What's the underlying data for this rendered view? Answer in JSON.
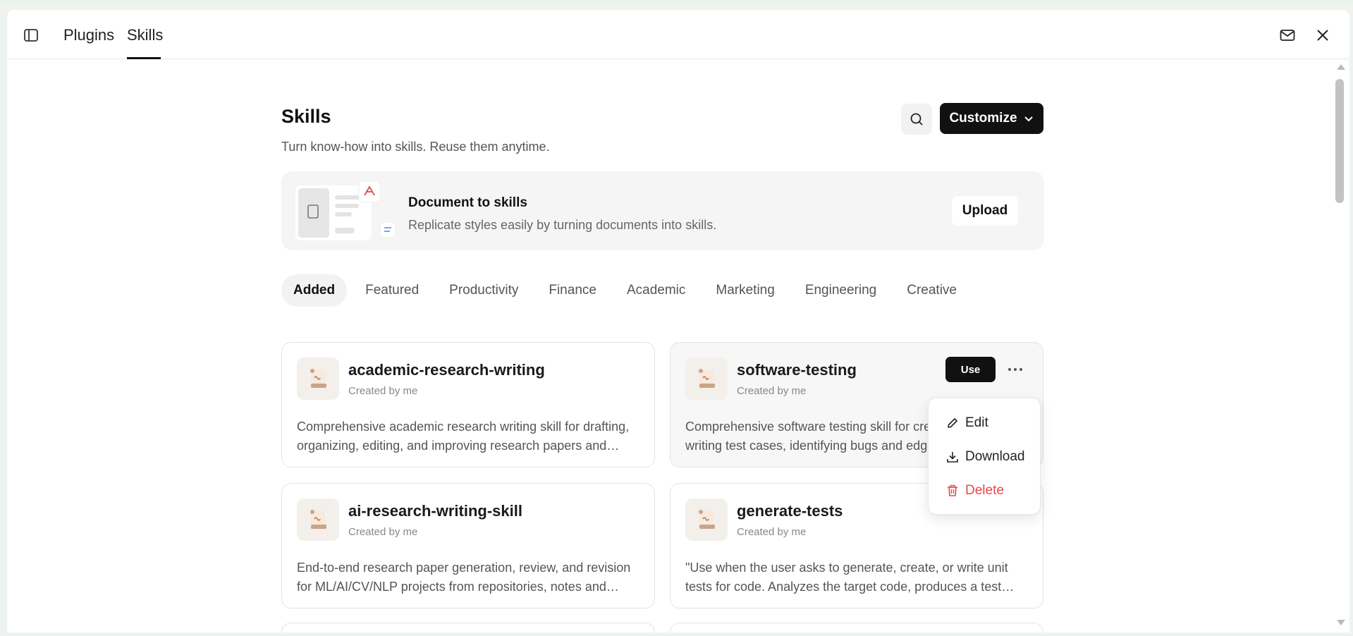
{
  "header": {
    "tabs": [
      {
        "label": "Plugins",
        "active": false
      },
      {
        "label": "Skills",
        "active": true
      }
    ],
    "icons": [
      "sidebar-toggle-icon",
      "mail-icon",
      "close-icon"
    ]
  },
  "page": {
    "title": "Skills",
    "subtitle": "Turn know-how into skills. Reuse them anytime.",
    "customize_label": "Customize"
  },
  "banner": {
    "title": "Document to skills",
    "subtitle": "Replicate styles easily by turning documents into skills.",
    "upload_label": "Upload"
  },
  "categories": [
    "Added",
    "Featured",
    "Productivity",
    "Finance",
    "Academic",
    "Marketing",
    "Engineering",
    "Creative"
  ],
  "active_category": "Added",
  "cards": [
    {
      "name": "academic-research-writing",
      "creator": "Created by me",
      "description": "Comprehensive academic research writing skill for drafting, organizing, editing, and improving research papers and manuscripts."
    },
    {
      "name": "software-testing",
      "creator": "Created by me",
      "description": "Comprehensive software testing skill for creating test plans, writing test cases, identifying bugs and edge cases.",
      "use_label": "Use"
    },
    {
      "name": "ai-research-writing-skill",
      "creator": "Created by me",
      "description": "End-to-end research paper generation, review, and revision for ML/AI/CV/NLP projects from repositories, notes and experiments."
    },
    {
      "name": "generate-tests",
      "creator": "Created by me",
      "description": "\"Use when the user asks to generate, create, or write unit tests for code. Analyzes the target code, produces a test suite."
    }
  ],
  "context_menu": {
    "edit": "Edit",
    "download": "Download",
    "delete": "Delete"
  },
  "colors": {
    "accent_dark": "#111111",
    "danger": "#e5484d",
    "banner_bg": "#f5f5f5"
  }
}
